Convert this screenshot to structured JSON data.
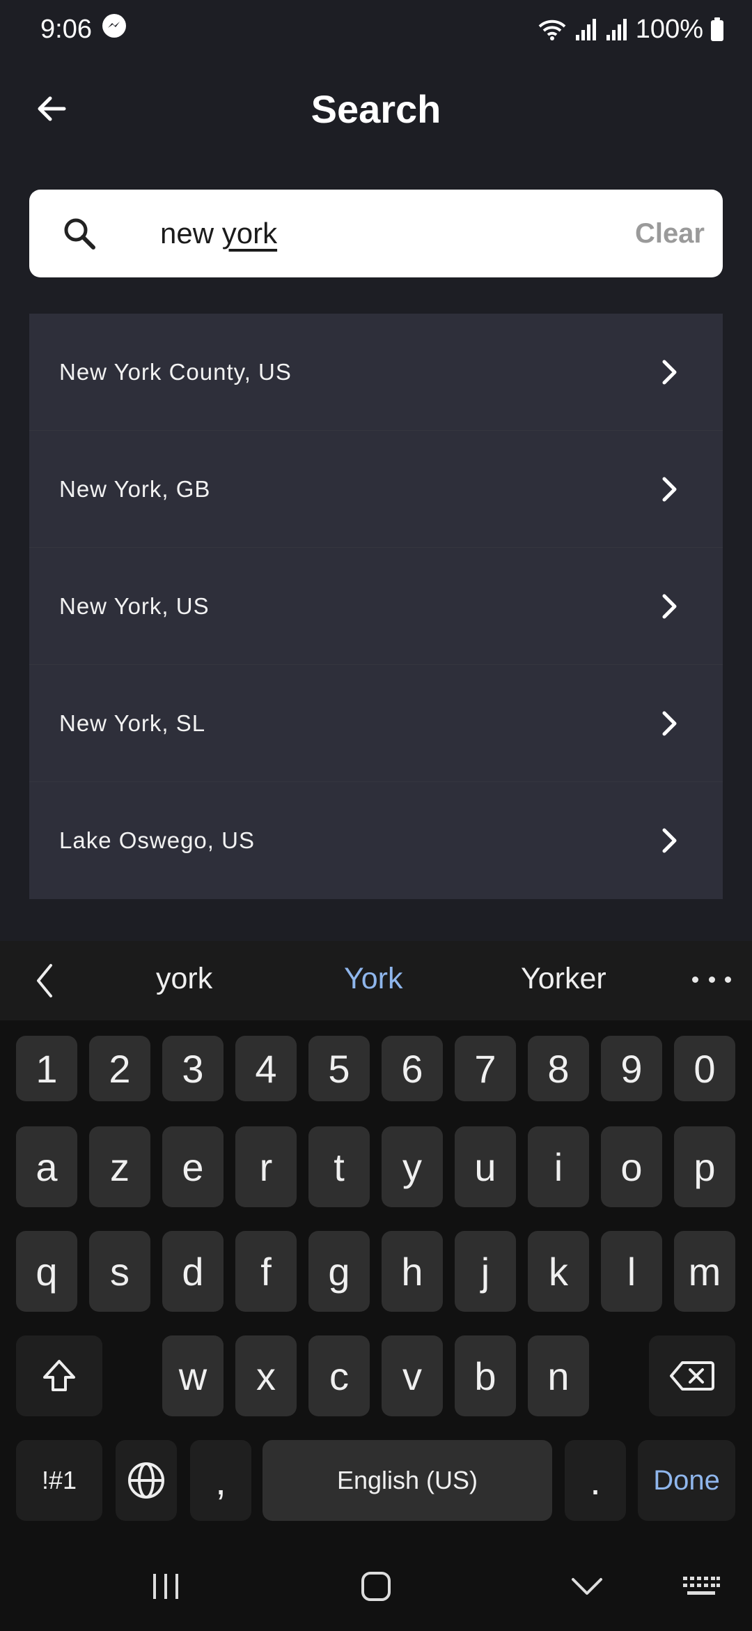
{
  "status_bar": {
    "time": "9:06",
    "battery": "100%",
    "icons": [
      "messenger-icon",
      "wifi-icon",
      "signal-icon",
      "signal-icon",
      "battery-icon"
    ]
  },
  "header": {
    "title": "Search",
    "back_icon": "arrow-left-icon"
  },
  "search": {
    "value_prefix": "new ",
    "value_underlined": "york",
    "clear_label": "Clear",
    "icon": "search-icon"
  },
  "results": [
    {
      "label": "New York County, US"
    },
    {
      "label": "New York, GB"
    },
    {
      "label": "New York, US"
    },
    {
      "label": "New York, SL"
    },
    {
      "label": "Lake Oswego, US"
    }
  ],
  "keyboard": {
    "suggestions": [
      "york",
      "York",
      "Yorker"
    ],
    "row_numbers": [
      "1",
      "2",
      "3",
      "4",
      "5",
      "6",
      "7",
      "8",
      "9",
      "0"
    ],
    "row1": [
      "a",
      "z",
      "e",
      "r",
      "t",
      "y",
      "u",
      "i",
      "o",
      "p"
    ],
    "row2": [
      "q",
      "s",
      "d",
      "f",
      "g",
      "h",
      "j",
      "k",
      "l",
      "m"
    ],
    "row3": [
      "w",
      "x",
      "c",
      "v",
      "b",
      "n"
    ],
    "symbols_label": "!#1",
    "comma_label": ",",
    "space_label": "English (US)",
    "period_label": ".",
    "done_label": "Done"
  },
  "colors": {
    "background": "#1d1e24",
    "list_background": "#2e2f3a",
    "accent": "#8fb6ec",
    "clear_text": "#9a9a9a"
  }
}
